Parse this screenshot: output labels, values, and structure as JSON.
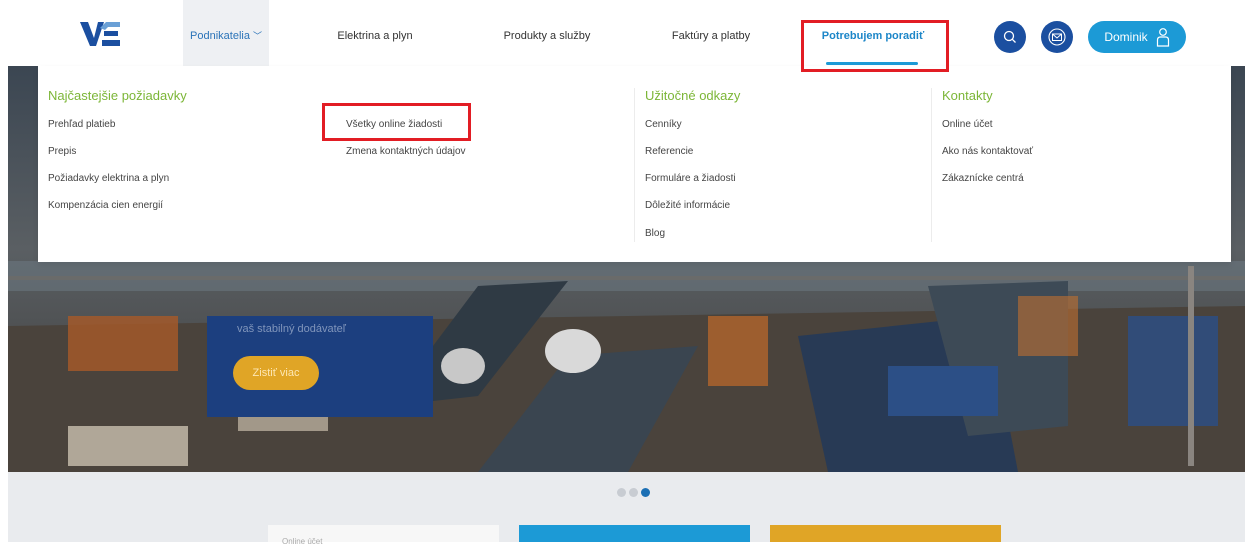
{
  "header": {
    "logo_alt": "VSE logo",
    "nav": [
      {
        "label": "Podnikatelia"
      },
      {
        "label": "Elektrina a plyn"
      },
      {
        "label": "Produkty a služby"
      },
      {
        "label": "Faktúry a platby"
      },
      {
        "label": "Potrebujem poradiť"
      }
    ],
    "user_label": "Dominik",
    "icons": {
      "search": "search-icon",
      "mail": "mail-icon",
      "user": "user-icon"
    }
  },
  "hero": {
    "promo_text": "vaš stabilný dodávateľ",
    "promo_button": "Zistiť viac"
  },
  "menu": {
    "col1_title": "Najčastejšie požiadavky",
    "col1_links": [
      "Prehľad platieb",
      "Prepis",
      "Požiadavky elektrina a plyn",
      "Kompenzácia cien energií"
    ],
    "col2_links": [
      "Všetky online žiadosti",
      "Zmena kontaktných údajov"
    ],
    "col3_title": "Užitočné odkazy",
    "col3_links": [
      "Cenníky",
      "Referencie",
      "Formuláre a žiadosti",
      "Dôležité informácie",
      "Blog"
    ],
    "col4_title": "Kontakty",
    "col4_links": [
      "Online účet",
      "Ako nás kontaktovať",
      "Zákaznícke centrá"
    ]
  },
  "lower": {
    "card1_text": "Online účet"
  },
  "colors": {
    "brand_blue": "#1b4fa0",
    "accent_cyan": "#1c9ad6",
    "menu_green": "#7cb637",
    "highlight_red": "#e21d24",
    "button_gold": "#e0a526"
  }
}
